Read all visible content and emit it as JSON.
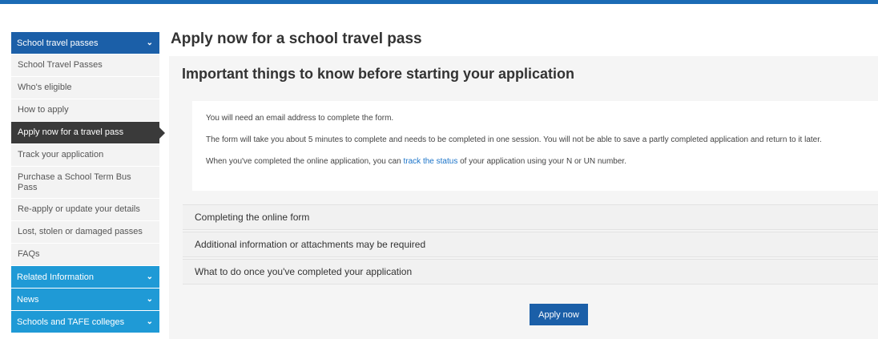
{
  "colors": {
    "accent": "#1b5fa8",
    "submenu": "#1f9ad6",
    "active": "#3a3a3a",
    "link": "#1a73c8"
  },
  "sidebar": {
    "header": {
      "label": "School travel passes",
      "icon": "chevron-down-icon"
    },
    "items": [
      {
        "label": "School Travel Passes"
      },
      {
        "label": "Who's eligible"
      },
      {
        "label": "How to apply"
      },
      {
        "label": "Apply now for a travel pass"
      },
      {
        "label": "Track your application"
      },
      {
        "label": "Purchase a School Term Bus Pass"
      },
      {
        "label": "Re-apply or update your details"
      },
      {
        "label": "Lost, stolen or damaged passes"
      },
      {
        "label": "FAQs"
      }
    ],
    "sections": [
      {
        "label": "Related Information",
        "icon": "chevron-down-icon"
      },
      {
        "label": "News",
        "icon": "chevron-down-icon"
      },
      {
        "label": "Schools and TAFE colleges",
        "icon": "chevron-down-icon"
      }
    ]
  },
  "main": {
    "title": "Apply now for a school travel pass",
    "section_title": "Important things to know before starting your application",
    "info": {
      "line1": "You will need an email address to complete the form.",
      "line2": "The form will take you about 5 minutes to complete and needs to be completed in one session. You will not be able to save a partly completed application and return to it later.",
      "line3_pre": "When you've completed the online application, you can ",
      "line3_link": "track the status",
      "line3_post": " of your application using your N or UN number."
    },
    "accordions": [
      {
        "label": "Completing the online form"
      },
      {
        "label": "Additional information or attachments may be required"
      },
      {
        "label": "What to do once you've completed your application"
      }
    ],
    "apply_button": "Apply now"
  }
}
